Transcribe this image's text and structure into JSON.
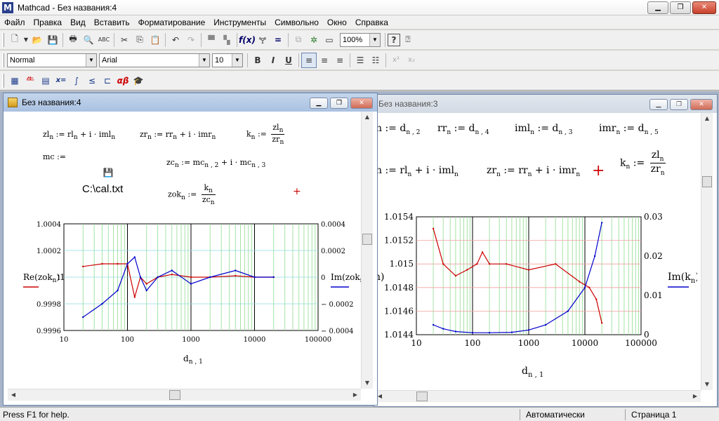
{
  "app": {
    "title": "Mathcad - Без названия:4",
    "logo": "M"
  },
  "menu": [
    "Файл",
    "Правка",
    "Вид",
    "Вставить",
    "Форматирование",
    "Инструменты",
    "Символьно",
    "Окно",
    "Справка"
  ],
  "toolbar": {
    "zoom": "100%",
    "style": "Normal",
    "font": "Arial",
    "size": "10",
    "bold": "B",
    "italic": "I",
    "underline": "U"
  },
  "windows": {
    "front": {
      "title": "Без названия:4",
      "file_path": "C:\\cal.txt",
      "eq_mc": "mc :=",
      "chart": {
        "y_ticks": [
          "1.0004",
          "1.0002",
          "1",
          "0.9998",
          "0.9996"
        ],
        "y2_ticks": [
          "0.0004",
          "0.0002",
          "0",
          "− 0.0002",
          "− 0.0004"
        ],
        "x_ticks": [
          "10",
          "100",
          "1000",
          "10000",
          "100000"
        ],
        "ylabel": "Re(zok",
        "y2label": "Im(zok",
        "xlabel": "d",
        "colors": {
          "re": "#cc0000",
          "im": "#0000cc"
        }
      }
    },
    "back": {
      "title": "Без названия:3",
      "chart": {
        "y_ticks": [
          "1.0154",
          "1.0152",
          "1.015",
          "1.0148",
          "1.0146",
          "1.0144"
        ],
        "y2_ticks": [
          "0.03",
          "0.02",
          "0.01",
          "0"
        ],
        "x_ticks": [
          "10",
          "100",
          "1000",
          "10000",
          "100000"
        ],
        "ylabel_partial": "n)",
        "y2label": "Im(k",
        "xlabel": "d",
        "colors": {
          "re": "#cc0000",
          "im": "#0000cc"
        }
      }
    }
  },
  "chart_data": [
    {
      "type": "line",
      "title": "",
      "x_scale": "log",
      "xlim": [
        10,
        100000
      ],
      "ylim": [
        0.9996,
        1.0004
      ],
      "y2lim": [
        -0.0004,
        0.0004
      ],
      "series": [
        {
          "name": "Re(zok)",
          "axis": "left",
          "x": [
            20,
            40,
            70,
            100,
            130,
            160,
            200,
            300,
            500,
            1000,
            2000,
            5000,
            10000,
            20000
          ],
          "values": [
            1.00008,
            1.0001,
            1.0001,
            1.0001,
            0.99985,
            1.0,
            0.99995,
            1.0,
            1.00002,
            1.0,
            1.0,
            1.00001,
            1.0,
            1.0
          ]
        },
        {
          "name": "Im(zok)",
          "axis": "right",
          "x": [
            20,
            40,
            70,
            100,
            130,
            160,
            200,
            300,
            500,
            1000,
            2000,
            5000,
            10000,
            20000
          ],
          "values": [
            -0.0003,
            -0.0002,
            -0.0001,
            0.0001,
            0.00015,
            0.0,
            -0.0001,
            0.0,
            5e-05,
            -5e-05,
            0.0,
            5e-05,
            0.0,
            0.0
          ]
        }
      ]
    },
    {
      "type": "line",
      "title": "",
      "x_scale": "log",
      "xlim": [
        10,
        100000
      ],
      "ylim": [
        1.0144,
        1.0154
      ],
      "y2lim": [
        0,
        0.03
      ],
      "series": [
        {
          "name": "Re(k)",
          "axis": "left",
          "x": [
            20,
            30,
            50,
            80,
            120,
            150,
            200,
            400,
            1000,
            3000,
            8000,
            12000,
            16000,
            20000
          ],
          "values": [
            1.0153,
            1.015,
            1.0149,
            1.01495,
            1.015,
            1.0151,
            1.015,
            1.015,
            1.01495,
            1.015,
            1.01485,
            1.0148,
            1.0147,
            1.0145
          ]
        },
        {
          "name": "Im(k)",
          "axis": "right",
          "x": [
            20,
            30,
            50,
            100,
            200,
            500,
            1000,
            2000,
            5000,
            10000,
            15000,
            20000
          ],
          "values": [
            0.0025,
            0.0015,
            0.0008,
            0.0005,
            0.0005,
            0.0006,
            0.0012,
            0.0025,
            0.006,
            0.012,
            0.02,
            0.0285
          ]
        }
      ]
    }
  ],
  "status": {
    "help": "Press F1 for help.",
    "mode": "Автоматически",
    "page": "Страница 1"
  }
}
